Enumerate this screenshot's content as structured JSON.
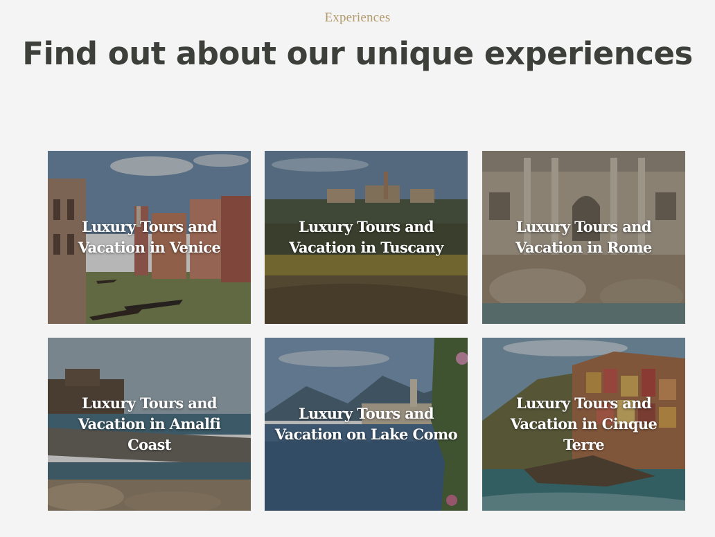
{
  "section": {
    "eyebrow": "Experiences",
    "headline": "Find out about our unique experiences"
  },
  "cards": [
    {
      "title": "Luxury Tours and Vacation in Venice"
    },
    {
      "title": "Luxury Tours and Vacation in Tuscany"
    },
    {
      "title": "Luxury Tours and Vacation in Rome"
    },
    {
      "title": "Luxury Tours and Vacation in Amalfi Coast"
    },
    {
      "title": "Luxury Tours and Vacation on Lake Como"
    },
    {
      "title": "Luxury Tours and Vacation in Cinque Terre"
    }
  ],
  "colors": {
    "background": "#f4f4f4",
    "eyebrow": "#b39a6c",
    "headline": "#3d3f3a",
    "card_title": "#ffffff"
  }
}
